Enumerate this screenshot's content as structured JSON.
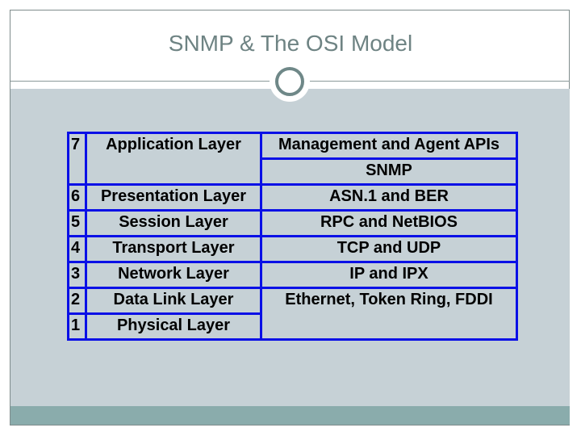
{
  "slide": {
    "title": "SNMP & The OSI Model",
    "decor": {
      "ring_icon": "circle-ring-icon",
      "accent_color": "#6f8888",
      "content_bg_color": "#c6d1d6",
      "footer_band_color": "#8aacac",
      "table_border_color": "#0a10e6"
    }
  },
  "table": {
    "rows": [
      {
        "number": "7",
        "layer": "Application Layer",
        "protocols": [
          "Management and Agent APIs",
          "SNMP"
        ]
      },
      {
        "number": "6",
        "layer": "Presentation Layer",
        "protocols": [
          "ASN.1 and BER"
        ]
      },
      {
        "number": "5",
        "layer": "Session Layer",
        "protocols": [
          "RPC and NetBIOS"
        ]
      },
      {
        "number": "4",
        "layer": "Transport Layer",
        "protocols": [
          "TCP and UDP"
        ]
      },
      {
        "number": "3",
        "layer": "Network Layer",
        "protocols": [
          "IP and IPX"
        ]
      },
      {
        "number": "2",
        "layer": "Data Link Layer",
        "protocols": [
          "Ethernet, Token Ring, FDDI"
        ]
      },
      {
        "number": "1",
        "layer": "Physical Layer",
        "protocols": []
      }
    ]
  }
}
